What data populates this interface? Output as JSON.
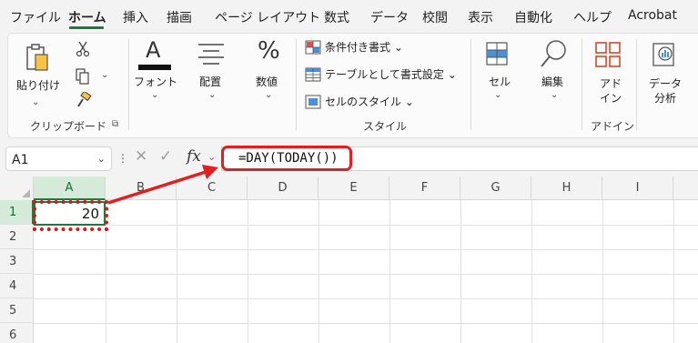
{
  "menu_tabs": [
    "ファイル",
    "ホーム",
    "挿入",
    "描画",
    "ページ レイアウト",
    "数式",
    "データ",
    "校閲",
    "表示",
    "自動化",
    "ヘルプ",
    "Acrobat"
  ],
  "ribbon": {
    "clipboard": {
      "paste_label": "貼り付け",
      "group_label": "クリップボード"
    },
    "font_label": "フォント",
    "alignment_label": "配置",
    "number_label": "数値",
    "styles": {
      "conditional": "条件付き書式 ⌄",
      "format_table": "テーブルとして書式設定 ⌄",
      "cell_styles": "セルのスタイル ⌄",
      "group_label": "スタイル"
    },
    "cells_label": "セル",
    "editing_label": "編集",
    "addins": {
      "label_line1": "アド",
      "label_line2": "イン",
      "group_label": "アドイン"
    },
    "analysis": {
      "label_line1": "データ",
      "label_line2": "分析"
    }
  },
  "formula_bar": {
    "name_box": "A1",
    "fx": "fx",
    "formula": "=DAY(TODAY())"
  },
  "grid": {
    "columns": [
      "A",
      "B",
      "C",
      "D",
      "E",
      "F",
      "G",
      "H",
      "I"
    ],
    "rows": [
      "1",
      "2",
      "3",
      "4",
      "5",
      "6"
    ],
    "cell_a1": "20"
  },
  "colors": {
    "accent_green": "#1e7b3f",
    "highlight_red": "#e02020"
  }
}
